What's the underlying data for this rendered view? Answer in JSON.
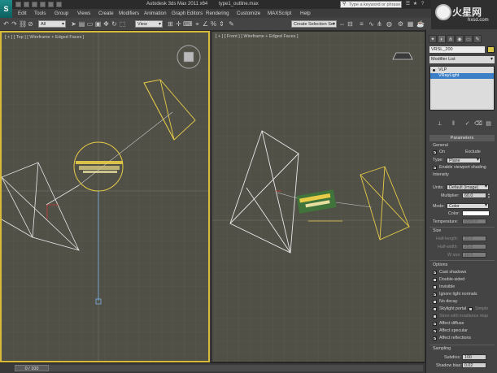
{
  "titlebar": {
    "app_logo": "S",
    "title": "Autodesk 3ds Max 2011 x64",
    "file": "type1_outline.max",
    "search_placeholder": "Type a keyword or phrase",
    "watermark_title": "火星网",
    "watermark_sub": "hxsd.com"
  },
  "menu": [
    "Edit",
    "Tools",
    "Group",
    "Views",
    "Create",
    "Modifiers",
    "Animation",
    "Graph Editors",
    "Rendering",
    "Customize",
    "MAXScript",
    "Help"
  ],
  "toolbar": {
    "selection_filter": "All",
    "ref_coord": "View",
    "named_selection": "Create Selection Set"
  },
  "viewports": {
    "left_label": "[ + ] [ Top ] [ Wireframe + Edged Faces ]",
    "right_label": "[ + ] [ Front ] [ Wireframe + Edged Faces ]"
  },
  "timeslider": {
    "value": "0 / 100"
  },
  "command_panel": {
    "object_name": "VRSL_200",
    "modifier_list": "Modifier List",
    "stack": [
      "VLP",
      "VRayLight"
    ],
    "rollout_title": "Parameters",
    "general": "General",
    "on": "On",
    "exclude": "Exclude",
    "type_label": "Type:",
    "type_value": "Plane",
    "enable_viewport_shading": "Enable viewport shading",
    "intensity": "Intensity",
    "units_label": "Units:",
    "units_value": "Default (image)",
    "multiplier_label": "Multiplier:",
    "multiplier_value": "60.0",
    "mode_label": "Mode:",
    "mode_value": "Color",
    "color_label": "Color:",
    "temperature_label": "Temperature:",
    "temperature_value": "6500.0",
    "size": "Size",
    "half_length_label": "Half-length:",
    "half_length_value": "25.0",
    "half_width_label": "Half-width:",
    "half_width_value": "25.0",
    "w_size_label": "W size",
    "w_size_value": "10.0",
    "options": "Options",
    "cast_shadows": "Cast shadows",
    "double_sided": "Double-sided",
    "invisible": "Invisible",
    "ignore_light_normals": "Ignore light normals",
    "no_decay": "No decay",
    "skylight_portal": "Skylight portal",
    "simple": "Simple",
    "store_irradiance": "Store with irradiance map",
    "affect_diffuse": "Affect diffuse",
    "affect_specular": "Affect specular",
    "affect_reflections": "Affect reflections",
    "sampling": "Sampling",
    "subdivs_label": "Subdivs:",
    "subdivs_value": "100",
    "shadow_bias_label": "Shadow bias:",
    "shadow_bias_value": "0.02"
  },
  "colors": {
    "active_viewport_border": "#d9b93a",
    "selected_object": "#e8cc47",
    "wire_white": "#e8e8e8",
    "viewport_bg": "#505047"
  },
  "icons": [
    "undo-icon",
    "redo-icon",
    "select-icon",
    "move-icon",
    "rotate-icon",
    "scale-icon",
    "snap-icon",
    "render-icon"
  ]
}
